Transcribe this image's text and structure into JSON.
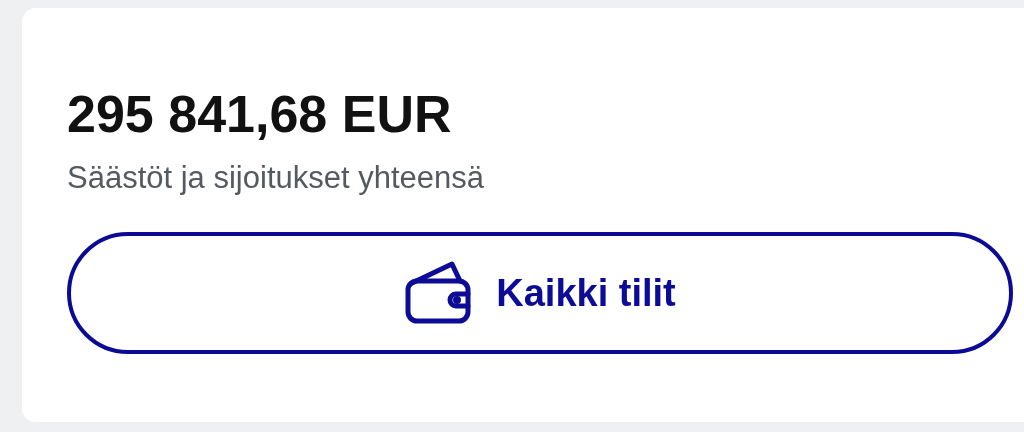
{
  "summary": {
    "amount": "295 841,68 EUR",
    "caption": "Säästöt ja sijoitukset yhteensä"
  },
  "button": {
    "label": "Kaikki tilit"
  }
}
